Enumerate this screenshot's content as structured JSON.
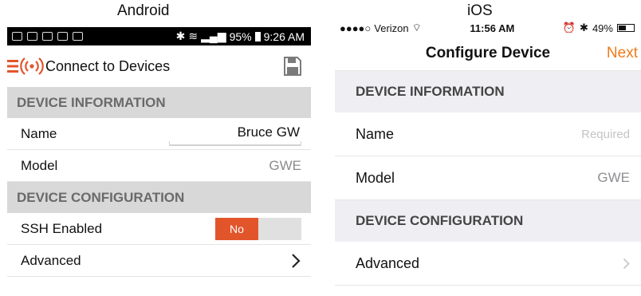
{
  "android": {
    "column_title": "Android",
    "status_bar": {
      "battery": "95%",
      "time": "9:26 AM"
    },
    "toolbar": {
      "title": "Connect to Devices",
      "save_icon": "save-icon",
      "logo_icon": "menu-broadcast-icon"
    },
    "sections": [
      {
        "header": "DEVICE INFORMATION"
      },
      {
        "header": "DEVICE CONFIGURATION"
      }
    ],
    "rows": {
      "name": {
        "label": "Name",
        "value": "Bruce GW"
      },
      "model": {
        "label": "Model",
        "value": "GWE"
      },
      "ssh": {
        "label": "SSH Enabled",
        "toggle": "No"
      },
      "advanced": {
        "label": "Advanced"
      }
    },
    "accent": "#e2552b"
  },
  "ios": {
    "column_title": "iOS",
    "status_bar": {
      "carrier": "Verizon",
      "time": "11:56 AM",
      "battery": "49%"
    },
    "nav": {
      "title": "Configure Device",
      "next_label": "Next"
    },
    "sections": [
      {
        "header": "DEVICE INFORMATION"
      },
      {
        "header": "DEVICE CONFIGURATION"
      }
    ],
    "rows": {
      "name": {
        "label": "Name",
        "placeholder": "Required"
      },
      "model": {
        "label": "Model",
        "value": "GWE"
      },
      "advanced": {
        "label": "Advanced"
      }
    },
    "accent": "#f07a1a"
  }
}
